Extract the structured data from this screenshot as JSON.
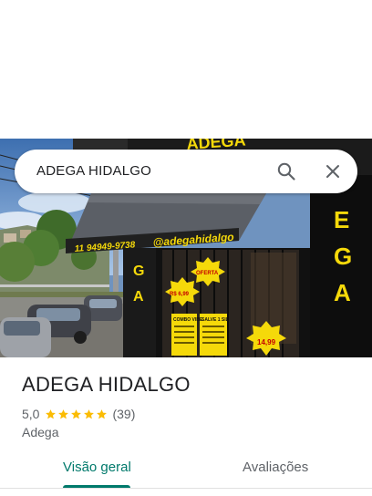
{
  "search": {
    "query": "ADEGA HIDALGO"
  },
  "photo": {
    "storefront_phone": "11 94949-9738",
    "storefront_handle": "@adegahidalgo",
    "sign_letters": [
      "G",
      "A"
    ],
    "side_sign_letters": [
      "E",
      "G",
      "A"
    ],
    "price_tag_1": "R$ 6,99",
    "price_tag_2": "14,99",
    "promo_tag": "OFERTA",
    "menu_board_1": "COMBO VIBE",
    "menu_board_2": "SALVE 1 SIL"
  },
  "place": {
    "name": "ADEGA HIDALGO",
    "rating": "5,0",
    "star_count": 5,
    "review_count": "(39)",
    "category": "Adega"
  },
  "tabs": [
    {
      "label": "Visão geral",
      "active": true
    },
    {
      "label": "Avaliações",
      "active": false
    }
  ],
  "colors": {
    "accent": "#00796b",
    "star": "#fbbc04",
    "sign_yellow": "#f5d90a"
  },
  "icons": {
    "search": "search-icon",
    "close": "close-icon",
    "star": "star-icon"
  }
}
